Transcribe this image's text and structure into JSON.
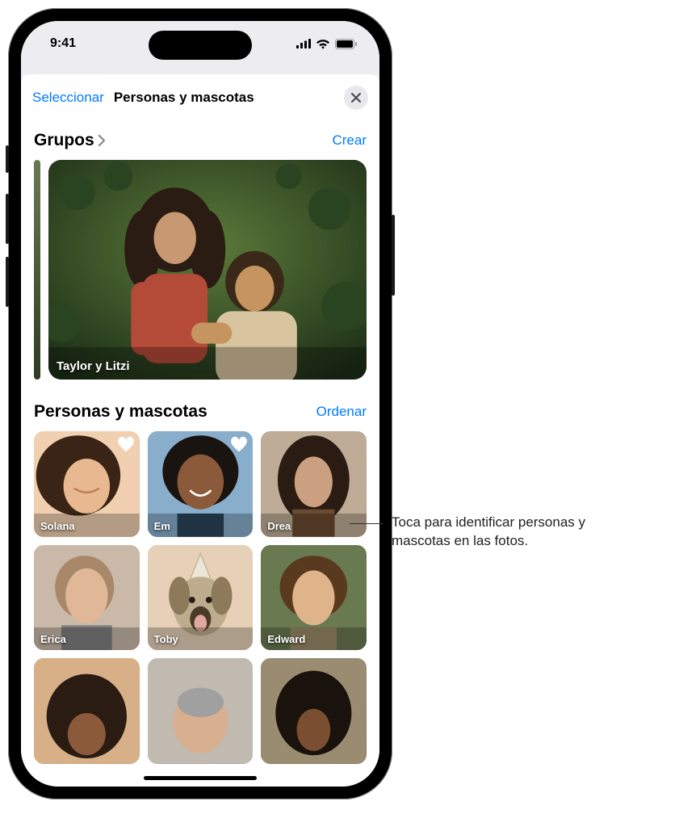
{
  "status": {
    "time": "9:41"
  },
  "nav": {
    "select": "Seleccionar",
    "title": "Personas y mascotas"
  },
  "groups": {
    "header": "Grupos",
    "action": "Crear",
    "card_label": "Taylor y Litzi"
  },
  "people": {
    "header": "Personas y mascotas",
    "action": "Ordenar",
    "tiles": [
      {
        "name": "Solana",
        "favorite": true
      },
      {
        "name": "Em",
        "favorite": true
      },
      {
        "name": "Drea",
        "favorite": false
      },
      {
        "name": "Erica",
        "favorite": false
      },
      {
        "name": "Toby",
        "favorite": false
      },
      {
        "name": "Edward",
        "favorite": false
      }
    ]
  },
  "callout": "Toca para identificar personas y mascotas en las fotos."
}
